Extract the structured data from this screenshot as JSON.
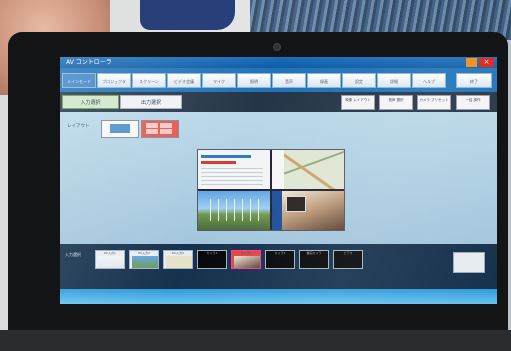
{
  "window": {
    "title": "AV コントローラ",
    "close_glyph": "×"
  },
  "nav": {
    "items": [
      {
        "label": "メインモード"
      },
      {
        "label": "プロジェクタ"
      },
      {
        "label": "スクリーン"
      },
      {
        "label": "ビデオ会議"
      },
      {
        "label": "マイク"
      },
      {
        "label": "照明"
      },
      {
        "label": "音声"
      },
      {
        "label": "録画"
      },
      {
        "label": "設定"
      },
      {
        "label": "詳細"
      },
      {
        "label": "ヘルプ"
      },
      {
        "label": "終了"
      }
    ]
  },
  "subtabs": {
    "items": [
      {
        "label": "入力選択"
      },
      {
        "label": "出力選択"
      }
    ]
  },
  "right_buttons": [
    {
      "label": "映像 レイアウト"
    },
    {
      "label": "音声 選択"
    },
    {
      "label": "カメラ プリセット"
    },
    {
      "label": "一括 操作"
    }
  ],
  "main": {
    "layout_label": "レイアウト"
  },
  "strip": {
    "label": "入力選択",
    "sources": [
      {
        "label": "PC入力1"
      },
      {
        "label": "PC入力2"
      },
      {
        "label": "PC入力3"
      },
      {
        "label": "カメラ1"
      },
      {
        "label": "カメラ2"
      },
      {
        "label": "カメラ3"
      },
      {
        "label": "書画カメラ"
      },
      {
        "label": "ビデオ"
      }
    ]
  },
  "colors": {
    "titlebar": "#1a6fbd",
    "selected_source": "#e0473f",
    "accent": "#2f9bd9"
  }
}
